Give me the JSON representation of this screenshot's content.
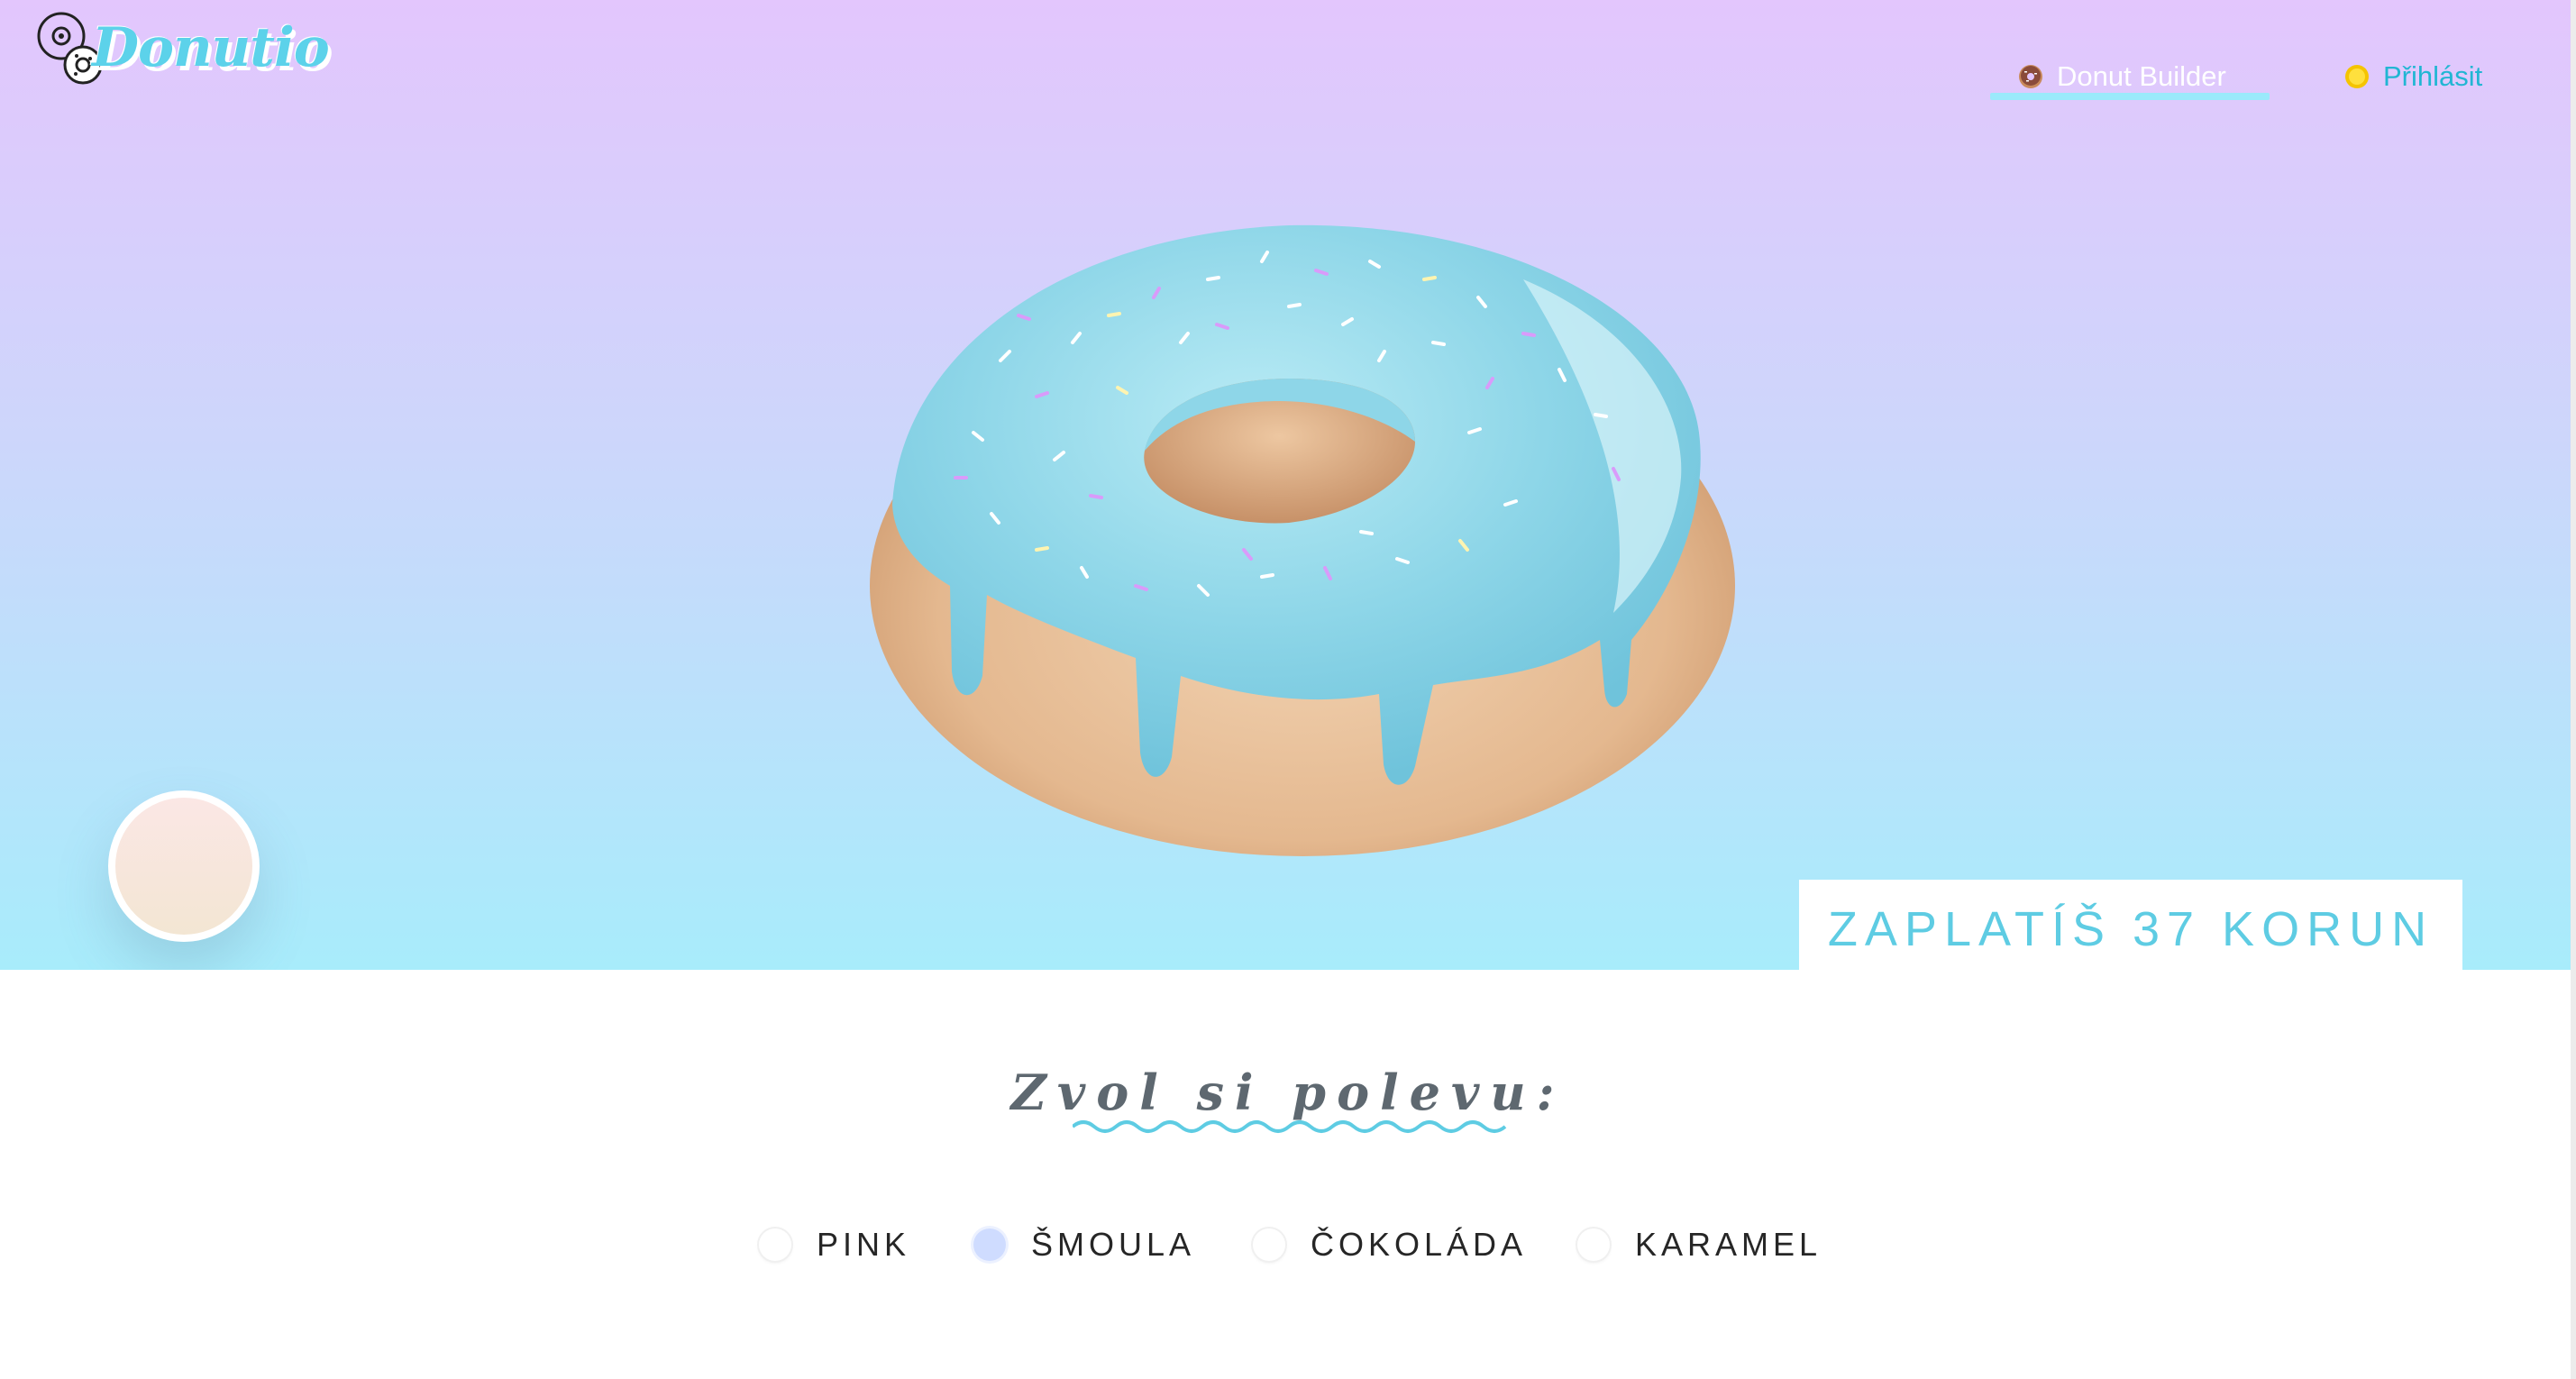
{
  "brand": {
    "name": "Donutio",
    "accent_color": "#5cd2ea"
  },
  "nav": {
    "builder_label": "Donut Builder",
    "builder_icon": "donut-icon",
    "login_label": "Přihlásit",
    "login_icon": "coin-icon"
  },
  "hero": {
    "gradient_top": "#e3c6fd",
    "gradient_bottom": "#a8ecfb",
    "donut": {
      "glaze": "Šmoula",
      "glaze_color": "#8fd3e6",
      "dough_color": "#e9c19b"
    },
    "base_swatch_icon": "dough-swatch"
  },
  "price": {
    "label": "ZAPLATÍŠ 37 KORUN"
  },
  "glaze_picker": {
    "title": "Zvol si polevu:",
    "options": [
      {
        "label": "PINK",
        "selected": false
      },
      {
        "label": "ŠMOULA",
        "selected": true
      },
      {
        "label": "ČOKOLÁDA",
        "selected": false
      },
      {
        "label": "KARAMEL",
        "selected": false
      }
    ],
    "selected_color": "#cfdcff"
  }
}
